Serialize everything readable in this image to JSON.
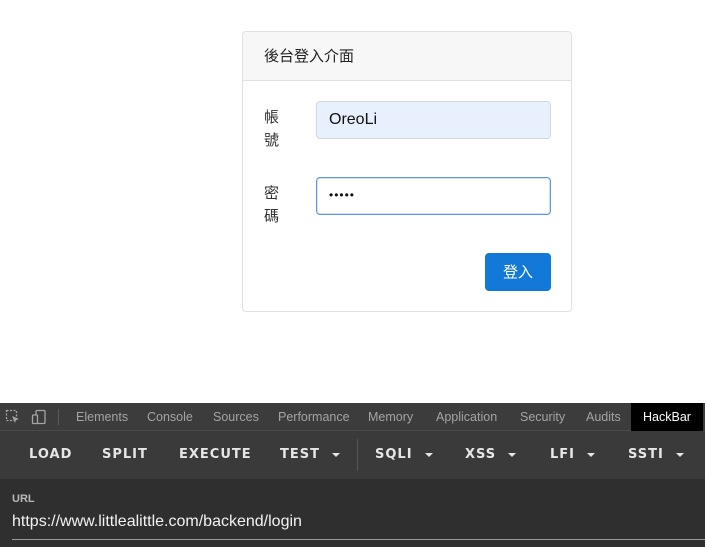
{
  "login": {
    "title": "後台登入介面",
    "account_label": "帳號",
    "account_value": "OreoLi",
    "password_label": "密碼",
    "password_value": "•••••",
    "submit_label": "登入"
  },
  "devtools": {
    "tabs": [
      "Elements",
      "Console",
      "Sources",
      "Performance",
      "Memory",
      "Application",
      "Security",
      "Audits",
      "HackBar"
    ],
    "active_tab": "HackBar"
  },
  "hackbar": {
    "buttons": [
      "LOAD",
      "SPLIT",
      "EXECUTE",
      "TEST",
      "SQLI",
      "XSS",
      "LFI",
      "SSTI"
    ],
    "url_label": "URL",
    "url_value": "https://www.littlealittle.com/backend/login"
  },
  "colors": {
    "primary_button": "#1279d8",
    "autofill_bg": "#e8f0fe",
    "devtools_bg": "#292a2d"
  }
}
